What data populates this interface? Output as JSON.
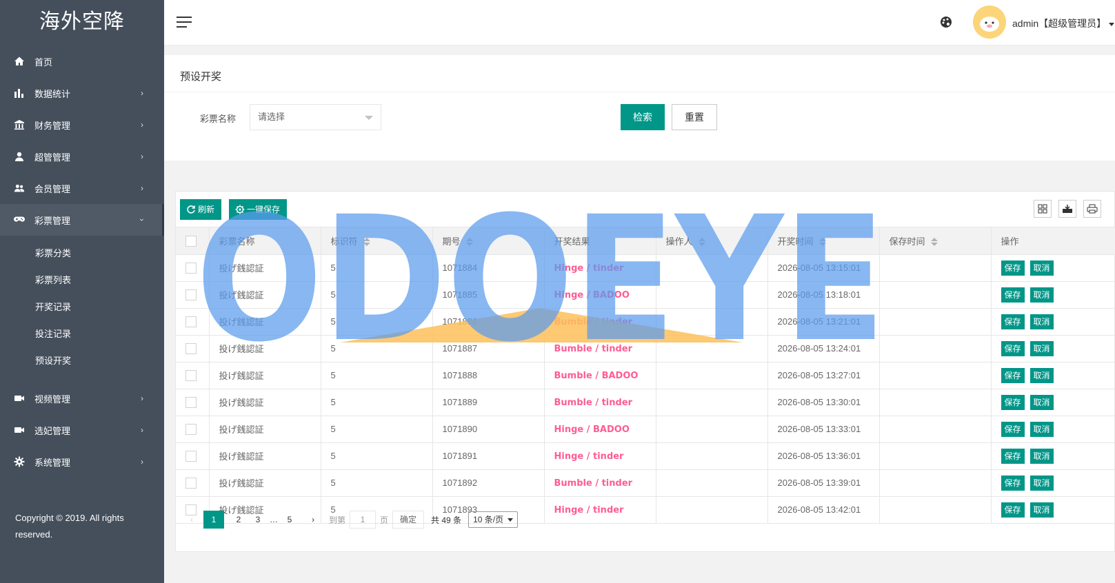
{
  "app": {
    "logo_text": "海外空降"
  },
  "sidebar": {
    "items": [
      {
        "label": "首页",
        "icon": "home-icon",
        "arrow": ""
      },
      {
        "label": "数据统计",
        "icon": "bar-chart-icon",
        "arrow": "›"
      },
      {
        "label": "财务管理",
        "icon": "bank-icon",
        "arrow": "›"
      },
      {
        "label": "超管管理",
        "icon": "user-icon",
        "arrow": "›"
      },
      {
        "label": "会员管理",
        "icon": "users-icon",
        "arrow": "›"
      },
      {
        "label": "彩票管理",
        "icon": "gamepad-icon",
        "arrow": "›",
        "expanded": true
      }
    ],
    "sub_items": [
      {
        "label": "彩票分类"
      },
      {
        "label": "彩票列表"
      },
      {
        "label": "开奖记录"
      },
      {
        "label": "投注记录"
      },
      {
        "label": "预设开奖"
      }
    ],
    "items_after": [
      {
        "label": "视频管理",
        "icon": "video-icon",
        "arrow": "›"
      },
      {
        "label": "选妃管理",
        "icon": "video-icon",
        "arrow": "›"
      },
      {
        "label": "系统管理",
        "icon": "gear-icon",
        "arrow": "›"
      }
    ],
    "copyright": "Copyright © 2019. All rights reserved."
  },
  "header": {
    "user_label": "admin【超级管理员】"
  },
  "panel": {
    "title": "预设开奖",
    "field_label": "彩票名称",
    "select_placeholder": "请选择",
    "search_button": "检索",
    "reset_button": "重置"
  },
  "toolbar": {
    "refresh_label": "刷新",
    "save_all_label": "一键保存"
  },
  "table": {
    "columns": [
      "彩票名称",
      "标识符",
      "期号",
      "开奖结果",
      "操作人",
      "开奖时间",
      "保存时间",
      "操作"
    ],
    "rows": [
      {
        "name": "投げ銭認証",
        "code": "5",
        "issue": "1071884",
        "result": "Hinge / tinder",
        "operator": "",
        "time": "2026-08-05 13:15:01",
        "saved": ""
      },
      {
        "name": "投げ銭認証",
        "code": "5",
        "issue": "1071885",
        "result": "Hinge / BADOO",
        "operator": "",
        "time": "2026-08-05 13:18:01",
        "saved": ""
      },
      {
        "name": "投げ銭認証",
        "code": "5",
        "issue": "1071886",
        "result": "Bumble / tinder",
        "operator": "",
        "time": "2026-08-05 13:21:01",
        "saved": ""
      },
      {
        "name": "投げ銭認証",
        "code": "5",
        "issue": "1071887",
        "result": "Bumble / tinder",
        "operator": "",
        "time": "2026-08-05 13:24:01",
        "saved": ""
      },
      {
        "name": "投げ銭認証",
        "code": "5",
        "issue": "1071888",
        "result": "Bumble / BADOO",
        "operator": "",
        "time": "2026-08-05 13:27:01",
        "saved": ""
      },
      {
        "name": "投げ銭認証",
        "code": "5",
        "issue": "1071889",
        "result": "Bumble / tinder",
        "operator": "",
        "time": "2026-08-05 13:30:01",
        "saved": ""
      },
      {
        "name": "投げ銭認証",
        "code": "5",
        "issue": "1071890",
        "result": "Hinge / BADOO",
        "operator": "",
        "time": "2026-08-05 13:33:01",
        "saved": ""
      },
      {
        "name": "投げ銭認証",
        "code": "5",
        "issue": "1071891",
        "result": "Hinge / tinder",
        "operator": "",
        "time": "2026-08-05 13:36:01",
        "saved": ""
      },
      {
        "name": "投げ銭認証",
        "code": "5",
        "issue": "1071892",
        "result": "Bumble / tinder",
        "operator": "",
        "time": "2026-08-05 13:39:01",
        "saved": ""
      },
      {
        "name": "投げ銭認証",
        "code": "5",
        "issue": "1071893",
        "result": "Hinge / tinder",
        "operator": "",
        "time": "2026-08-05 13:42:01",
        "saved": ""
      }
    ],
    "action_save": "保存",
    "action_cancel": "取消"
  },
  "pagination": {
    "prev": "‹",
    "pages": [
      "1",
      "2",
      "3"
    ],
    "current": "1",
    "ellipsis": "…",
    "last": "5",
    "next": "›",
    "goto_label": "到第",
    "goto_value": "1",
    "page_unit": "页",
    "confirm": "确定",
    "total": "共 49 条",
    "limit": "10 条/页"
  },
  "watermark": {
    "text": "ODOEYE"
  },
  "colors": {
    "sidebar": "#454f5c",
    "primary": "#009688",
    "result": "#ff5c93",
    "watermark_blue": "#5a9bed",
    "watermark_orange": "#fdc05a"
  }
}
